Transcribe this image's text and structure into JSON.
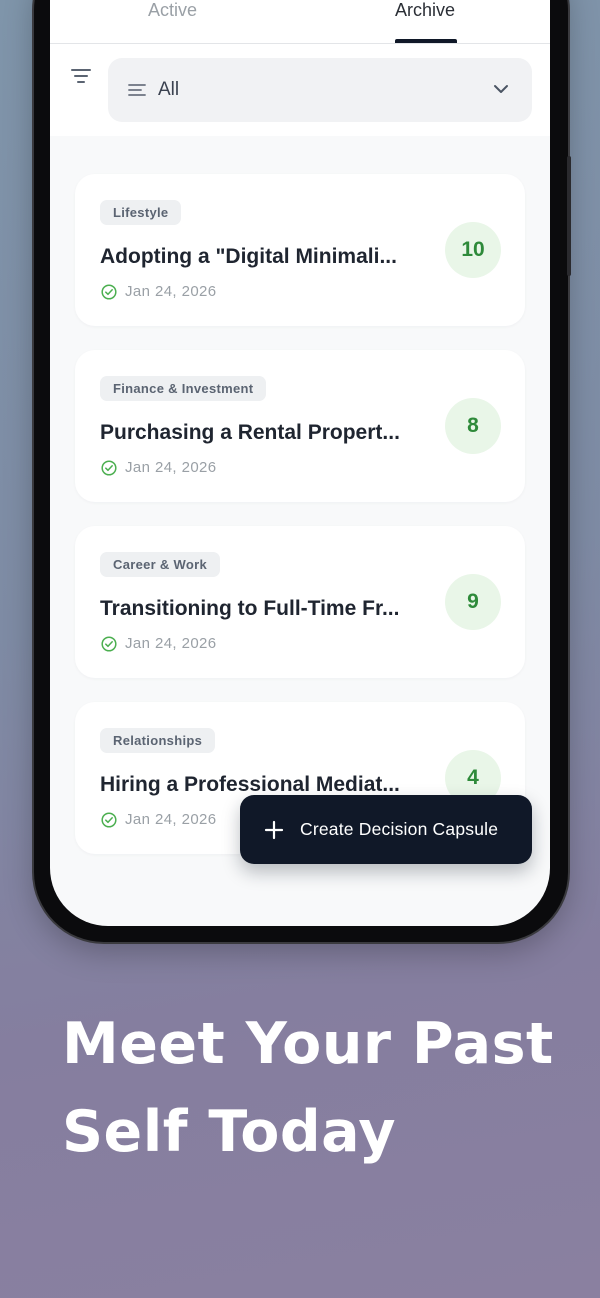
{
  "tabs": [
    {
      "label": "Active",
      "selected": false
    },
    {
      "label": "Archive",
      "selected": true
    }
  ],
  "filter": {
    "icon": "filter-icon",
    "selected_value": "All",
    "lines_icon": "sort-lines-icon",
    "chevron_icon": "chevron-down-icon"
  },
  "decisions": [
    {
      "category": "Lifestyle",
      "title": "Adopting a \"Digital Minimalism\"",
      "title_display": "Adopting a \"Digital Minimali...",
      "date": "Jan 24, 2026",
      "score": "10"
    },
    {
      "category": "Finance & Investment",
      "title_display": "Purchasing a Rental Propert...",
      "date": "Jan 24, 2026",
      "score": "8"
    },
    {
      "category": "Career & Work",
      "title_display": "Transitioning to Full-Time Fr...",
      "date": "Jan 24, 2026",
      "score": "9"
    },
    {
      "category": "Relationships",
      "title_display": "Hiring a Professional Mediat...",
      "date": "Jan 24, 2026",
      "score": "4"
    }
  ],
  "fab": {
    "label": "Create Decision Capsule",
    "icon": "plus-icon"
  },
  "headline": {
    "line1": "Meet Your Past",
    "line2": "Self Today"
  },
  "colors": {
    "accent_dark": "#101828",
    "score_green": "#2e8a3a",
    "score_bg": "#e9f6e8",
    "check_green": "#4caf50"
  }
}
